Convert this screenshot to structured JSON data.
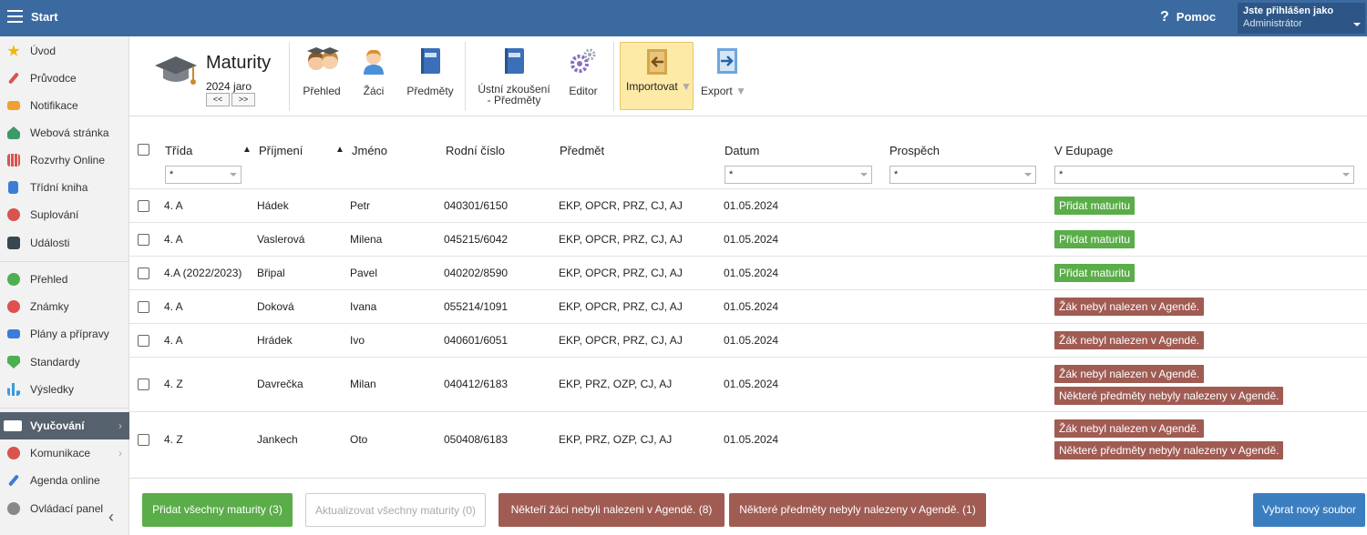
{
  "topbar": {
    "start": "Start",
    "help": "Pomoc",
    "user_line1": "Jste přihlášen jako",
    "user_line2": "Administrátor"
  },
  "sidebar": {
    "items": [
      {
        "label": "Úvod",
        "icon": "star-icon",
        "color": "#f2b705"
      },
      {
        "label": "Průvodce",
        "icon": "wand-icon",
        "color": "#d9534f"
      },
      {
        "label": "Notifikace",
        "icon": "envelope-icon",
        "color": "#f0a030"
      },
      {
        "label": "Webová stránka",
        "icon": "home-icon",
        "color": "#3a9a6a"
      },
      {
        "label": "Rozvrhy Online",
        "icon": "calendar-grid-icon",
        "color": "#d9534f"
      },
      {
        "label": "Třídní kniha",
        "icon": "book-icon",
        "color": "#3b7dd8"
      },
      {
        "label": "Suplování",
        "icon": "person-icon",
        "color": "#d9534f"
      },
      {
        "label": "Události",
        "icon": "calendar-icon",
        "color": "#37474f"
      },
      {
        "label": "Přehled",
        "icon": "check-circle-icon",
        "color": "#4caf50"
      },
      {
        "label": "Známky",
        "icon": "grade-icon",
        "color": "#e05050"
      },
      {
        "label": "Plány a přípravy",
        "icon": "briefcase-icon",
        "color": "#3b7dd8"
      },
      {
        "label": "Standardy",
        "icon": "shield-icon",
        "color": "#4caf50"
      },
      {
        "label": "Výsledky",
        "icon": "bar-chart-icon",
        "color": "#3b9ad8"
      },
      {
        "label": "Vyučování",
        "icon": "open-book-icon",
        "color": "#ffffff"
      },
      {
        "label": "Komunikace",
        "icon": "chat-icon",
        "color": "#d9534f"
      },
      {
        "label": "Agenda online",
        "icon": "pencil-icon",
        "color": "#3b7dd8"
      },
      {
        "label": "Ovládací panel",
        "icon": "gear-icon",
        "color": "#888888"
      }
    ]
  },
  "toolbar": {
    "title": "Maturity",
    "subtitle": "2024 jaro",
    "prev": "<<",
    "next": ">>",
    "buttons": {
      "prehled": "Přehled",
      "zaci": "Žáci",
      "predmety": "Předměty",
      "ustni_1": "Ústní zkoušení",
      "ustni_2": "- Předměty",
      "editor": "Editor",
      "importovat": "Importovat",
      "export": "Export"
    }
  },
  "table": {
    "headers": {
      "trida": "Třída",
      "prijmeni": "Příjmení",
      "jmeno": "Jméno",
      "rodne": "Rodní číslo",
      "predmet": "Předmět",
      "datum": "Datum",
      "prospech": "Prospěch",
      "vedupage": "V Edupage"
    },
    "filter_value": "*",
    "rows": [
      {
        "trida": "4. A",
        "prijmeni": "Hádek",
        "jmeno": "Petr",
        "rodne": "040301/6150",
        "predmet": "EKP, OPCR, PRZ, CJ, AJ",
        "datum": "01.05.2024",
        "tags": [
          "Přidat maturitu"
        ]
      },
      {
        "trida": "4. A",
        "prijmeni": "Vaslerová",
        "jmeno": "Milena",
        "rodne": "045215/6042",
        "predmet": "EKP, OPCR, PRZ, CJ, AJ",
        "datum": "01.05.2024",
        "tags": [
          "Přidat maturitu"
        ]
      },
      {
        "trida": "4.A (2022/2023)",
        "prijmeni": "Břipal",
        "jmeno": "Pavel",
        "rodne": "040202/8590",
        "predmet": "EKP, OPCR, PRZ, CJ, AJ",
        "datum": "01.05.2024",
        "tags": [
          "Přidat maturitu"
        ]
      },
      {
        "trida": "4. A",
        "prijmeni": "Doková",
        "jmeno": "Ivana",
        "rodne": "055214/1091",
        "predmet": "EKP, OPCR, PRZ, CJ, AJ",
        "datum": "01.05.2024",
        "tags": [
          "Žák nebyl nalezen v Agendě."
        ]
      },
      {
        "trida": "4. A",
        "prijmeni": "Hrádek",
        "jmeno": "Ivo",
        "rodne": "040601/6051",
        "predmet": "EKP, OPCR, PRZ, CJ, AJ",
        "datum": "01.05.2024",
        "tags": [
          "Žák nebyl nalezen v Agendě."
        ]
      },
      {
        "trida": "4. Z",
        "prijmeni": "Davrečka",
        "jmeno": "Milan",
        "rodne": "040412/6183",
        "predmet": "EKP, PRZ, OZP, CJ, AJ",
        "datum": "01.05.2024",
        "tags": [
          "Žák nebyl nalezen v Agendě.",
          "Některé předměty nebyly nalezeny v Agendě."
        ]
      },
      {
        "trida": "4. Z",
        "prijmeni": "Jankech",
        "jmeno": "Oto",
        "rodne": "050408/6183",
        "predmet": "EKP, PRZ, OZP, CJ, AJ",
        "datum": "01.05.2024",
        "tags": [
          "Žák nebyl nalezen v Agendě.",
          "Některé předměty nebyly nalezeny v Agendě."
        ]
      }
    ]
  },
  "footer": {
    "add_all": "Přidat všechny maturity (3)",
    "update_all": "Aktualizovat všechny maturity (0)",
    "students_missing": "Někteří žáci nebyli nalezeni v Agendě. (8)",
    "subjects_missing": "Některé předměty nebyly nalezeny v Agendě. (1)",
    "new_file": "Vybrat nový soubor"
  },
  "colors": {
    "topbar": "#3b6aa0",
    "green": "#5aad48",
    "red": "#a05b53",
    "blue": "#3b7ec0"
  }
}
